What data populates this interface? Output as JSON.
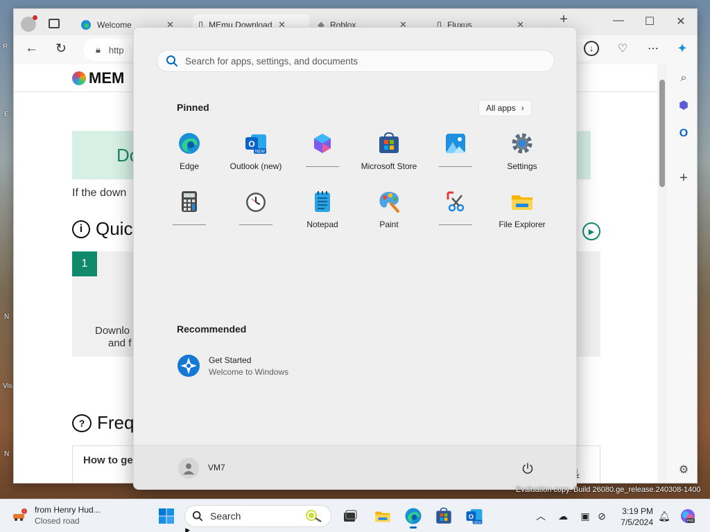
{
  "browser": {
    "tabs": [
      {
        "title": "Welcome",
        "icon": "edge-icon"
      },
      {
        "title": "MEmu Download -",
        "icon": "page-icon"
      },
      {
        "title": "Roblox",
        "icon": "roblox-icon"
      },
      {
        "title": "Fluxus",
        "icon": "page-icon"
      }
    ],
    "new_tab": "+",
    "url_text": "http",
    "page": {
      "logo_text": "MEM",
      "banner_text": "Do",
      "download_text": "If the down",
      "quick_heading": "Quic",
      "step_number": "1",
      "step_text_1": "Downlo",
      "step_text_2": "and f",
      "faq_heading": "Freq",
      "faq_item": "How to ge"
    }
  },
  "start_menu": {
    "search_placeholder": "Search for apps, settings, and documents",
    "pinned_title": "Pinned",
    "all_apps_label": "All apps",
    "pinned_apps": [
      {
        "label": "Edge",
        "icon": "edge-icon"
      },
      {
        "label": "Outlook (new)",
        "icon": "outlook-icon"
      },
      {
        "label": "",
        "icon": "copilot-icon"
      },
      {
        "label": "Microsoft Store",
        "icon": "store-icon"
      },
      {
        "label": "",
        "icon": "photos-icon"
      },
      {
        "label": "Settings",
        "icon": "settings-icon"
      },
      {
        "label": "",
        "icon": "calculator-icon"
      },
      {
        "label": "",
        "icon": "clock-icon"
      },
      {
        "label": "Notepad",
        "icon": "notepad-icon"
      },
      {
        "label": "Paint",
        "icon": "paint-icon"
      },
      {
        "label": "",
        "icon": "snipping-tool-icon"
      },
      {
        "label": "File Explorer",
        "icon": "file-explorer-icon"
      }
    ],
    "recommended_title": "Recommended",
    "recommended": [
      {
        "title": "Get Started",
        "subtitle": "Welcome to Windows",
        "icon": "get-started-icon"
      }
    ],
    "user_name": "VM7"
  },
  "watermark": "Evaluation copy. Build 26080.ge_release.240308-1400",
  "taskbar": {
    "weather_title": "from Henry Hud...",
    "weather_subtitle": "Closed road",
    "search_label": "Search",
    "time": "3:19 PM",
    "date": "7/5/2024"
  },
  "colors": {
    "accent": "#0067c0",
    "start_bg": "#efefef",
    "taskbar_bg": "#eef1f6",
    "memu_green": "#0f8a6b"
  }
}
